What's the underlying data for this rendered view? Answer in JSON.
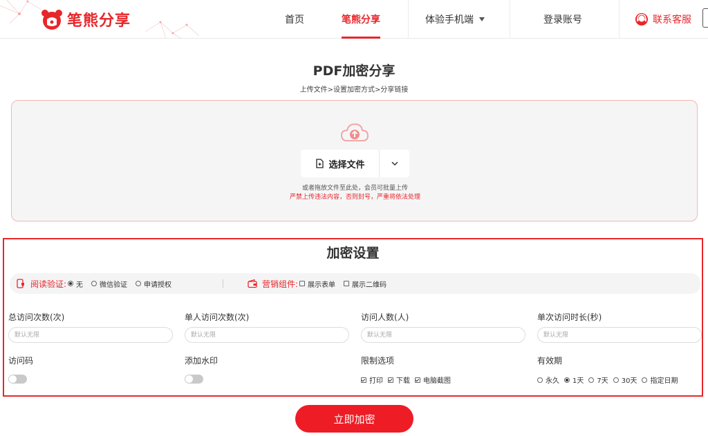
{
  "header": {
    "brand": "笔熊分享",
    "nav": {
      "home": "首页",
      "share": "笔熊分享",
      "mobile": "体验手机端",
      "login": "登录账号",
      "support": "联系客服"
    }
  },
  "page": {
    "title": "PDF加密分享",
    "steps": "上传文件>设置加密方式>分享链接"
  },
  "upload": {
    "select_button": "选择文件",
    "hint": "或者拖放文件至此处，会员可批量上传",
    "warning": "严禁上传违法内容，否则封号，严重将依法处理"
  },
  "settings": {
    "title": "加密设置",
    "read_verify": {
      "label": "阅读验证:",
      "options": [
        "无",
        "微信验证",
        "申请授权"
      ],
      "selected": "无"
    },
    "marketing": {
      "label": "营销组件:",
      "options": [
        "展示表单",
        "展示二维码"
      ]
    },
    "fields": {
      "total_visits": {
        "label": "总访问次数(次)",
        "placeholder": "默认无限"
      },
      "per_user_visits": {
        "label": "单人访问次数(次)",
        "placeholder": "默认无限"
      },
      "visitors": {
        "label": "访问人数(人)",
        "placeholder": "默认无限"
      },
      "duration": {
        "label": "单次访问时长(秒)",
        "placeholder": "默认无限"
      }
    },
    "access_code": {
      "label": "访问码",
      "on": false
    },
    "watermark": {
      "label": "添加水印",
      "on": false
    },
    "restrictions": {
      "label": "限制选项",
      "options": [
        "打印",
        "下载",
        "电脑截图"
      ],
      "checked": [
        "打印",
        "下载",
        "电脑截图"
      ]
    },
    "validity": {
      "label": "有效期",
      "options": [
        "永久",
        "1天",
        "7天",
        "30天",
        "指定日期"
      ],
      "selected": "1天"
    }
  },
  "submit_label": "立即加密",
  "colors": {
    "brand_red": "#e8262a",
    "button_red": "#ee1c25",
    "upload_border": "#f3b7ae"
  }
}
